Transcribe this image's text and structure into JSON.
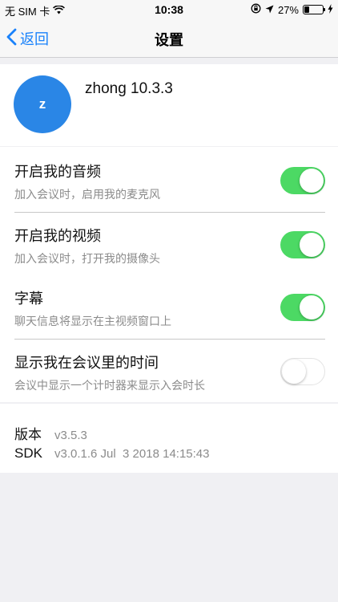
{
  "status_bar": {
    "carrier": "无 SIM 卡",
    "time": "10:38",
    "battery_percent": "27%",
    "battery_level": 0.27
  },
  "nav": {
    "back_label": "返回",
    "title": "设置"
  },
  "profile": {
    "avatar_letter": "z",
    "name": "zhong 10.3.3"
  },
  "settings": [
    {
      "title": "开启我的音频",
      "desc": "加入会议时，启用我的麦克风",
      "on": true
    },
    {
      "title": "开启我的视频",
      "desc": "加入会议时，打开我的摄像头",
      "on": true
    },
    {
      "title": "字幕",
      "desc": "聊天信息将显示在主视频窗口上",
      "on": true
    },
    {
      "title": "显示我在会议里的时间",
      "desc": "会议中显示一个计时器来显示入会时长",
      "on": false
    }
  ],
  "version": {
    "version_label": "版本",
    "version_value": "v3.5.3",
    "sdk_label": "SDK",
    "sdk_value": "v3.0.1.6 Jul  3 2018 14:15:43"
  },
  "colors": {
    "accent": "#1a82fb",
    "toggle_on": "#4cd964",
    "avatar": "#2a86e6"
  }
}
